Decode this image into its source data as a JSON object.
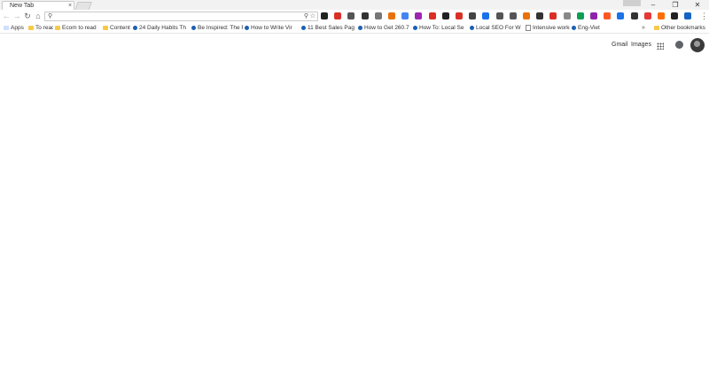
{
  "tab": {
    "title": "New Tab",
    "close": "×"
  },
  "window": {
    "minimize": "–",
    "restore": "❐",
    "close": "✕"
  },
  "toolbar": {
    "back": "←",
    "forward": "→",
    "reload": "↻",
    "home": "⌂",
    "omnibox_value": "",
    "search_glyph": "⚲",
    "zoom_glyph": "⚲",
    "star_glyph": "☆",
    "menu_glyph": "⋮"
  },
  "extensions": [
    {
      "color": "#222222"
    },
    {
      "color": "#d93025"
    },
    {
      "color": "#555555"
    },
    {
      "color": "#333333"
    },
    {
      "color": "#777777"
    },
    {
      "color": "#e8710a"
    },
    {
      "color": "#4285f4"
    },
    {
      "color": "#9c27b0"
    },
    {
      "color": "#d93025"
    },
    {
      "color": "#222222"
    },
    {
      "color": "#d93025"
    },
    {
      "color": "#444444"
    },
    {
      "color": "#1a73e8"
    },
    {
      "color": "#555555"
    },
    {
      "color": "#555555"
    },
    {
      "color": "#e8710a"
    },
    {
      "color": "#333333"
    },
    {
      "color": "#d93025"
    },
    {
      "color": "#888888"
    },
    {
      "color": "#0f9d58"
    },
    {
      "color": "#8e24aa"
    },
    {
      "color": "#ff5722"
    },
    {
      "color": "#1a73e8"
    },
    {
      "color": "#333333"
    },
    {
      "color": "#e53935"
    },
    {
      "color": "#ff6d00"
    },
    {
      "color": "#222222"
    },
    {
      "color": "#1565c0"
    }
  ],
  "bookmarks": {
    "items": [
      {
        "label": "Apps",
        "icon": "apps-grid-icon"
      },
      {
        "label": "To read",
        "icon": "folder-icon"
      },
      {
        "label": "Ecom to read",
        "icon": "folder-icon"
      },
      {
        "label": "Content",
        "icon": "folder-icon"
      },
      {
        "label": "24 Daily Habits Th",
        "icon": "site-icon"
      },
      {
        "label": "Be Inspired: The F",
        "icon": "site-icon"
      },
      {
        "label": "How to Write Vir",
        "icon": "site-icon"
      },
      {
        "label": "11 Best Sales Pag",
        "icon": "site-icon"
      },
      {
        "label": "How to Get 260.7",
        "icon": "site-icon"
      },
      {
        "label": "How To: Local Se",
        "icon": "site-icon"
      },
      {
        "label": "Local SEO For W",
        "icon": "site-icon"
      },
      {
        "label": "Intensive workou",
        "icon": "doc-icon"
      },
      {
        "label": "Eng-Viet",
        "icon": "google-icon"
      }
    ],
    "overflow": "»",
    "other": "Other bookmarks"
  },
  "ntp": {
    "gmail": "Gmail",
    "images": "Images"
  }
}
